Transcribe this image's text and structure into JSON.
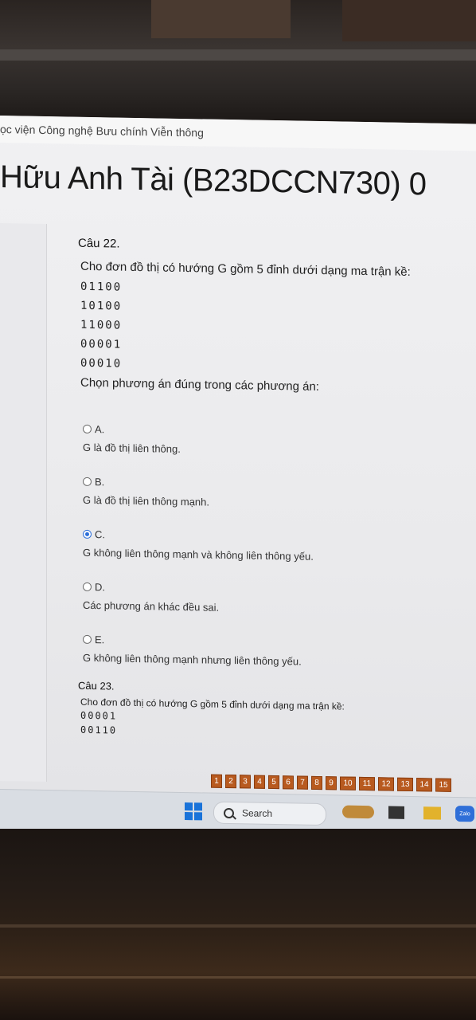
{
  "header": {
    "site_name": "ọc viện Công nghệ Bưu chính Viễn thông",
    "student_name": "Hữu Anh Tài (B23DCCN730) 0"
  },
  "question_22": {
    "label": "Câu 22.",
    "text": "Cho đơn đồ thị có hướng G gồm 5 đỉnh dưới dạng ma trận kề:",
    "matrix": [
      "01100",
      "10100",
      "11000",
      "00001",
      "00010"
    ],
    "instruction": "Chọn phương án đúng trong các phương án:",
    "options": [
      {
        "letter": "A.",
        "text": "G là đồ thị liên thông.",
        "selected": false
      },
      {
        "letter": "B.",
        "text": "G là đồ thị liên thông mạnh.",
        "selected": false
      },
      {
        "letter": "C.",
        "text": "G không liên thông mạnh và không liên thông yếu.",
        "selected": true
      },
      {
        "letter": "D.",
        "text": "Các phương án khác đều sai.",
        "selected": false
      },
      {
        "letter": "E.",
        "text": "G không liên thông mạnh nhưng liên thông yếu.",
        "selected": false
      }
    ]
  },
  "question_23": {
    "label": "Câu 23.",
    "text": "Cho đơn đồ thị có hướng G gồm 5 đỉnh dưới dạng ma trận kề:",
    "matrix": [
      "00001",
      "00110"
    ]
  },
  "question_nav": {
    "buttons": [
      "1",
      "2",
      "3",
      "4",
      "5",
      "6",
      "7",
      "8",
      "9",
      "10",
      "11",
      "12",
      "13",
      "14",
      "15"
    ]
  },
  "taskbar": {
    "search_label": "Search",
    "zalo_label": "Zalo",
    "icons": [
      "windows-start-icon",
      "search-icon",
      "weather-widget-icon",
      "widgets-icon",
      "file-explorer-icon",
      "zalo-icon"
    ]
  },
  "colors": {
    "nav_button": "#b85a1f",
    "radio_selected": "#2e6fd8",
    "taskbar": "#d9dde3"
  }
}
